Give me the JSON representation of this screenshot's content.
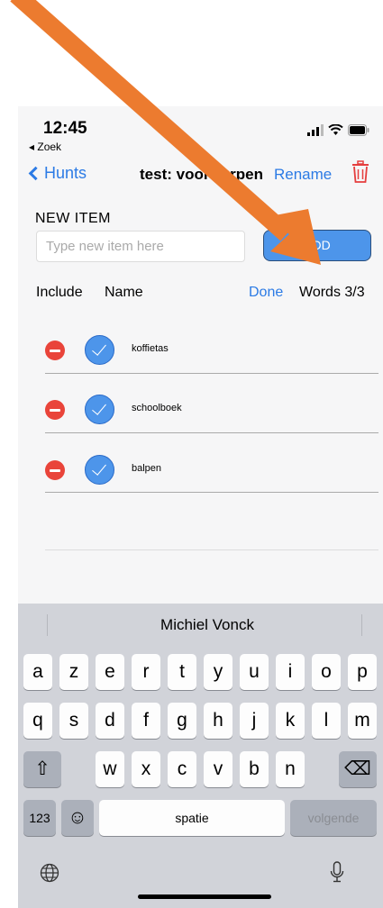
{
  "status_bar": {
    "time": "12:45",
    "back_app": "◂ Zoek"
  },
  "nav": {
    "back_label": "Hunts",
    "title": "test: voorwerpen",
    "rename_label": "Rename"
  },
  "new_item": {
    "label": "NEW ITEM",
    "placeholder": "Type new item here",
    "add_label": "ADD"
  },
  "list_header": {
    "include": "Include",
    "name": "Name",
    "done": "Done",
    "words": "Words 3/3"
  },
  "items": [
    {
      "name": "koffietas",
      "included": true
    },
    {
      "name": "schoolboek",
      "included": true
    },
    {
      "name": "balpen",
      "included": true
    }
  ],
  "keyboard": {
    "suggestion": "Michiel Vonck",
    "row1": [
      "a",
      "z",
      "e",
      "r",
      "t",
      "y",
      "u",
      "i",
      "o",
      "p"
    ],
    "row2": [
      "q",
      "s",
      "d",
      "f",
      "g",
      "h",
      "j",
      "k",
      "l",
      "m"
    ],
    "row3": [
      "w",
      "x",
      "c",
      "v",
      "b",
      "n"
    ],
    "numbers_label": "123",
    "space_label": "spatie",
    "return_label": "volgende",
    "shift_icon": "⇧",
    "delete_icon": "⌫",
    "emoji_icon": "☺",
    "globe_icon": "globe",
    "mic_icon": "microphone"
  },
  "colors": {
    "accent": "#2c7be5",
    "delete": "#e9443a",
    "check": "#4d95ea",
    "arrow": "#ec7b2f"
  }
}
